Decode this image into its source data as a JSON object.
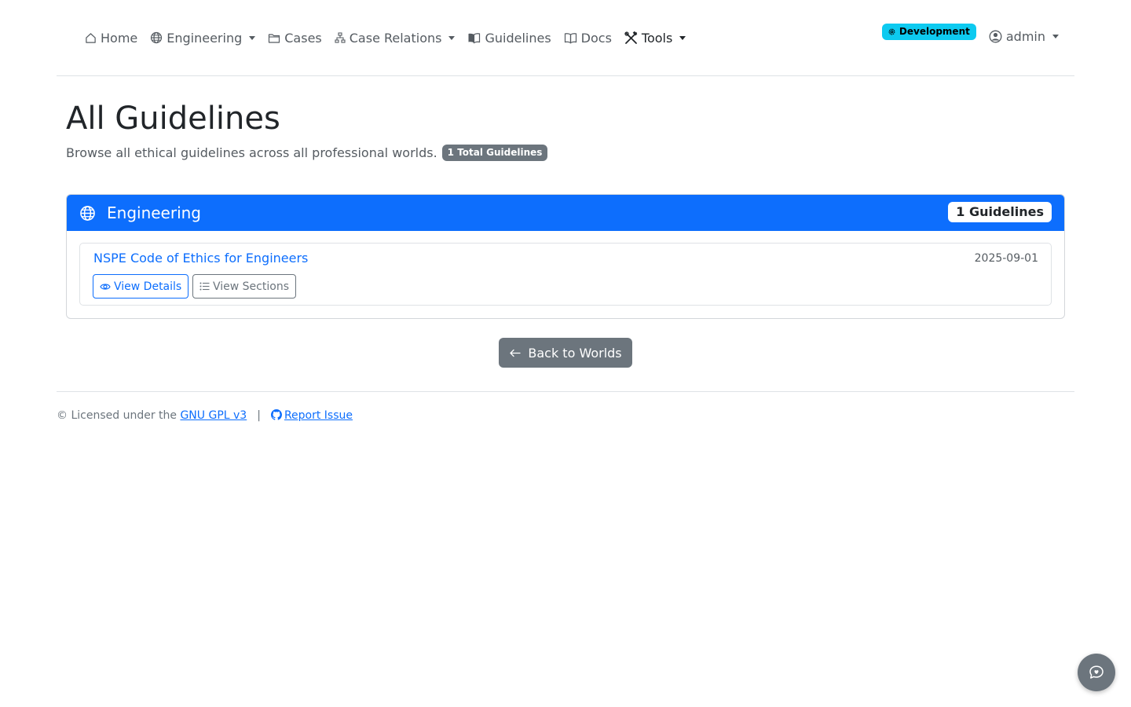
{
  "nav": {
    "items": [
      {
        "label": "Home",
        "icon": "house-icon"
      },
      {
        "label": "Engineering",
        "icon": "globe-icon",
        "dropdown": true
      },
      {
        "label": "Cases",
        "icon": "folder-icon"
      },
      {
        "label": "Case Relations",
        "icon": "diagram-icon",
        "dropdown": true
      },
      {
        "label": "Guidelines",
        "icon": "book-icon"
      },
      {
        "label": "Docs",
        "icon": "open-book-icon"
      },
      {
        "label": "Tools",
        "icon": "tools-icon",
        "dropdown": true
      }
    ],
    "environment_badge": "Development",
    "user": "admin"
  },
  "page": {
    "title": "All Guidelines",
    "subtitle": "Browse all ethical guidelines across all professional worlds.",
    "total_badge": "1 Total Guidelines"
  },
  "world_card": {
    "name": "Engineering",
    "count_badge": "1 Guidelines",
    "guidelines": [
      {
        "title": "NSPE Code of Ethics for Engineers",
        "date": "2025-09-01",
        "view_details_label": "View Details",
        "view_sections_label": "View Sections"
      }
    ]
  },
  "back_button": "Back to Worlds",
  "footer": {
    "license_prefix": "© Licensed under the",
    "license_link": "GNU GPL v3",
    "separator": "|",
    "report_link": "Report Issue"
  },
  "colors": {
    "primary": "#0d6efd",
    "secondary": "#6c757d",
    "info": "#0dcaf0"
  }
}
